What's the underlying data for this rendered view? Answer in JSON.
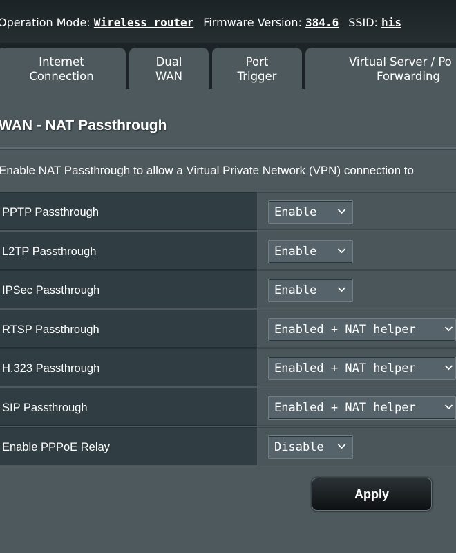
{
  "header": {
    "operation_mode_label": "Operation Mode:",
    "operation_mode_value": "Wireless router",
    "firmware_label": "Firmware Version:",
    "firmware_value": "384.6",
    "ssid_label": "SSID:",
    "ssid_value": "his"
  },
  "tabs": [
    {
      "line1": "Internet",
      "line2": "Connection"
    },
    {
      "line1": "Dual",
      "line2": "WAN"
    },
    {
      "line1": "Port",
      "line2": "Trigger"
    },
    {
      "line1": "Virtual Server / Po",
      "line2": "Forwarding"
    }
  ],
  "page": {
    "title": "WAN - NAT Passthrough",
    "description": "Enable NAT Passthrough to allow a Virtual Private Network (VPN) connection to"
  },
  "settings": [
    {
      "label": "PPTP Passthrough",
      "value": "Enable"
    },
    {
      "label": "L2TP Passthrough",
      "value": "Enable"
    },
    {
      "label": "IPSec Passthrough",
      "value": "Enable"
    },
    {
      "label": "RTSP Passthrough",
      "value": "Enabled + NAT helper"
    },
    {
      "label": "H.323 Passthrough",
      "value": "Enabled + NAT helper"
    },
    {
      "label": "SIP Passthrough",
      "value": "Enabled + NAT helper"
    },
    {
      "label": "Enable PPPoE Relay",
      "value": "Disable"
    }
  ],
  "apply_label": "Apply",
  "icons": {
    "dropdown": "chevron-down-icon"
  }
}
